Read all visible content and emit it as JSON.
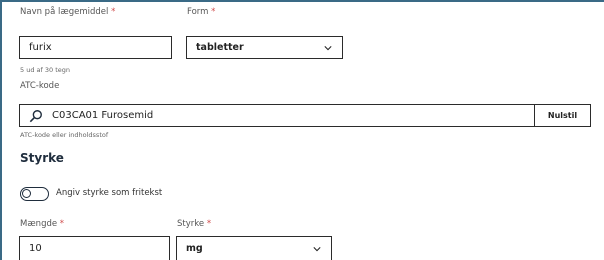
{
  "form": {
    "name_label": "Navn på lægemiddel",
    "required_marker": "*",
    "name_value": "furix",
    "name_hint": "5 ud af 30 tegn",
    "form_label": "Form",
    "form_value": "tabletter",
    "atc_label": "ATC-kode",
    "atc_value": "C03CA01 Furosemid",
    "reset_label": "Nulstil",
    "atc_hint": "ATC-kode eller indholdsstof",
    "strength_heading": "Styrke",
    "toggle_label": "Angiv styrke som fritekst",
    "amount_label": "Mængde",
    "amount_value": "10",
    "strength_label": "Styrke",
    "strength_value": "mg"
  },
  "icons": {
    "search": "search-icon",
    "dropdown": "chevron-down-icon"
  },
  "colors": {
    "border": "#2b2b2b",
    "required": "#d04a4a",
    "frame": "#3a6a86"
  }
}
